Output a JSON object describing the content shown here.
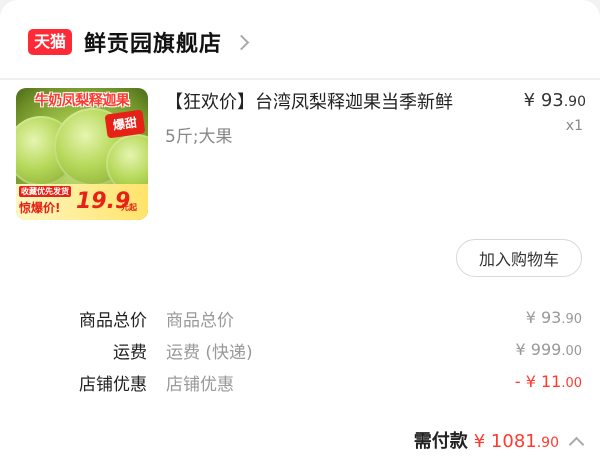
{
  "store": {
    "badge": "天猫",
    "name": "鲜贡园旗舰店"
  },
  "product": {
    "title": "【狂欢价】台湾凤梨释迦果当季新鲜",
    "spec": "5斤;大果",
    "price_symbol": "¥",
    "price_int": "93",
    "price_dec": ".90",
    "quantity": "x1",
    "image": {
      "title": "牛奶凤梨释迦果",
      "burst": "爆甜",
      "tag1": "收藏优先发货",
      "tag2": "惊爆价!",
      "price": "19.9",
      "price_suffix": "元起"
    }
  },
  "actions": {
    "add_cart_label": "加入购物车"
  },
  "summary": [
    {
      "label": "商品总价",
      "desc": "商品总价",
      "prefix": "¥ ",
      "int": "93",
      "dec": ".90"
    },
    {
      "label": "运费",
      "desc": "运费 (快递)",
      "prefix": "¥ ",
      "int": "999",
      "dec": ".00"
    },
    {
      "label": "店铺优惠",
      "desc": "店铺优惠",
      "prefix": "- ¥ ",
      "int": "11",
      "dec": ".00"
    }
  ],
  "total": {
    "label": "需付款",
    "prefix": "¥ ",
    "int": "1081",
    "dec": ".90"
  },
  "colors": {
    "accent": "#ff3b2f",
    "tmall": "#ff2a36"
  },
  "icons": [
    "chevron-right-icon",
    "chevron-up-icon"
  ]
}
